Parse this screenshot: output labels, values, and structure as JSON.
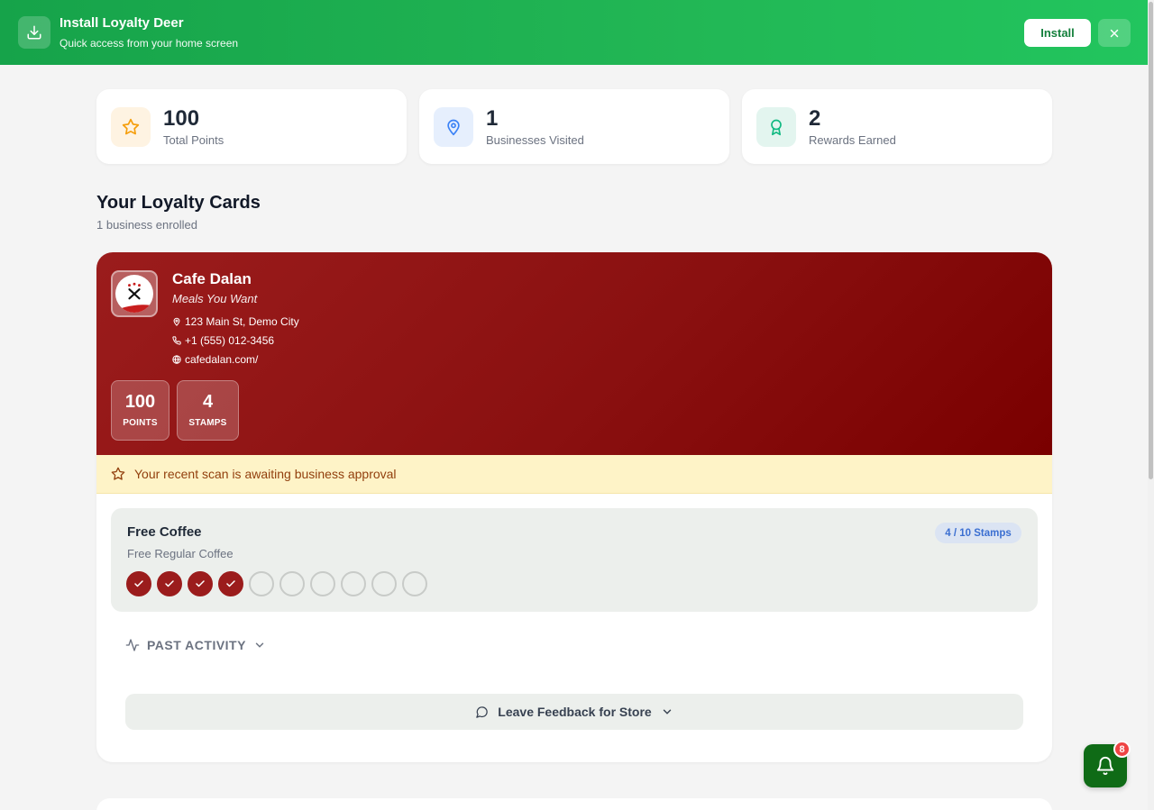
{
  "banner": {
    "title": "Install Loyalty Deer",
    "subtitle": "Quick access from your home screen",
    "install_label": "Install",
    "icon": "download-icon",
    "close_icon": "close-icon"
  },
  "stats": [
    {
      "value": "100",
      "label": "Total Points",
      "icon": "star-icon",
      "color": "#f59e0b"
    },
    {
      "value": "1",
      "label": "Businesses Visited",
      "icon": "map-pin-icon",
      "color": "#3b82f6"
    },
    {
      "value": "2",
      "label": "Rewards Earned",
      "icon": "award-icon",
      "color": "#10b981"
    }
  ],
  "section": {
    "title": "Your Loyalty Cards",
    "subtitle": "1 business enrolled"
  },
  "card": {
    "name": "Cafe Dalan",
    "tagline": "Meals You Want",
    "address": "123 Main St, Demo City",
    "phone": "+1 (555) 012-3456",
    "website": "cafedalan.com/",
    "points_value": "100",
    "points_label": "POINTS",
    "stamps_value": "4",
    "stamps_label": "STAMPS",
    "brand_color": "#9b1c1c",
    "alert": "Your recent scan is awaiting business approval",
    "reward": {
      "title": "Free Coffee",
      "description": "Free Regular Coffee",
      "badge": "4 / 10 Stamps",
      "stamps_filled": 4,
      "stamps_total": 10
    },
    "past_activity_label": "PAST ACTIVITY",
    "feedback_label": "Leave Feedback for Store"
  },
  "notifications": {
    "count": "8",
    "icon": "bell-icon"
  }
}
